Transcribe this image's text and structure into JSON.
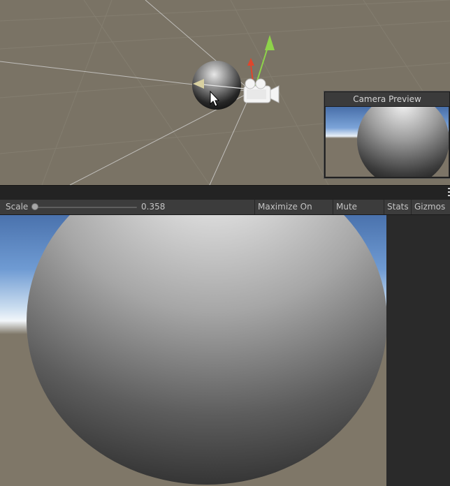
{
  "scene": {
    "camera_preview_title": "Camera Preview"
  },
  "toolbar": {
    "scale_label": "Scale",
    "scale_value": "0.358",
    "maximize_on_play": "Maximize On Play",
    "mute_audio": "Mute Audio",
    "stats": "Stats",
    "gizmos": "Gizmos"
  },
  "colors": {
    "scene_background": "#7a7365",
    "sky_blue": "#5e8ac6",
    "ground": "#7f7768",
    "toolbar": "#3c3c3c",
    "gizmo_y_axis": "#8ed34a",
    "gizmo_x_axis": "#e0452c"
  },
  "icons": {
    "camera_gizmo": "camera-icon",
    "cursor": "mouse-pointer-icon",
    "more_menu": "vertical-dots-icon"
  }
}
